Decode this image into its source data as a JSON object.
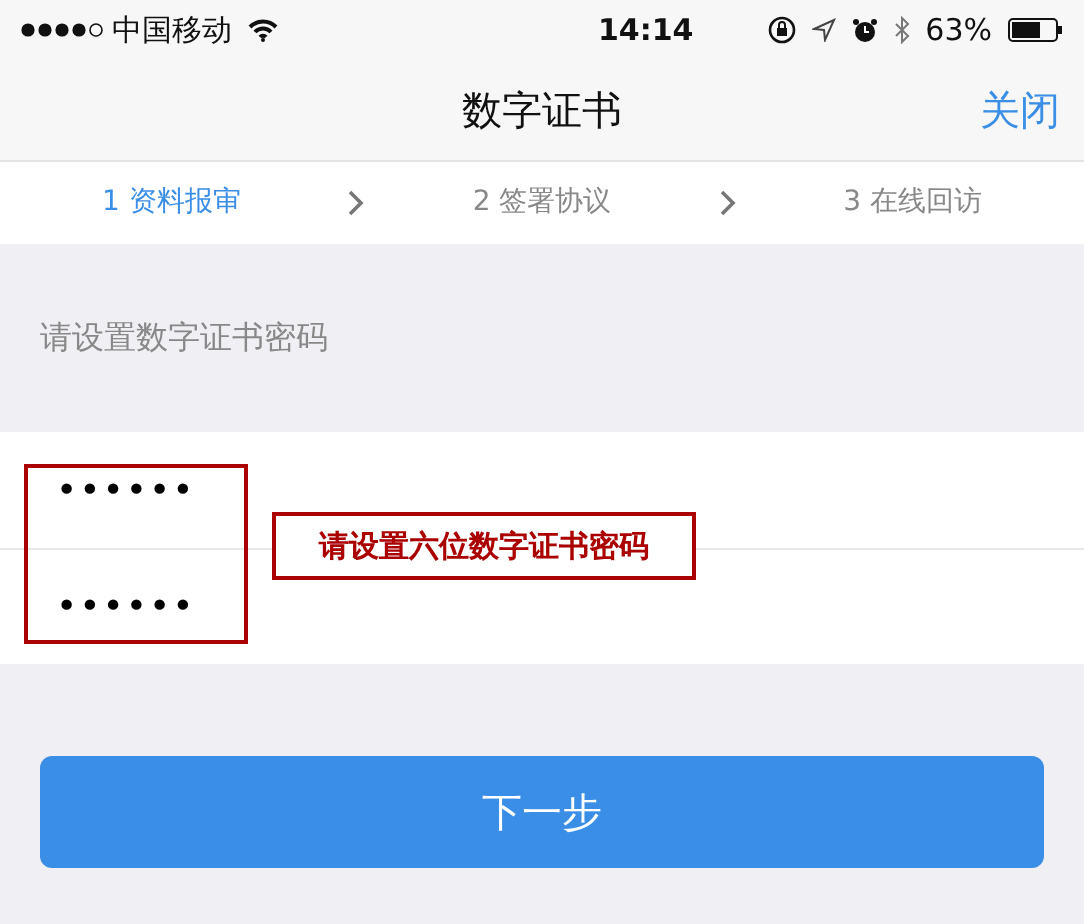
{
  "status_bar": {
    "carrier": "中国移动",
    "time": "14:14",
    "battery": "63%"
  },
  "nav_bar": {
    "title": "数字证书",
    "close": "关闭"
  },
  "steps": [
    {
      "label": "1 资料报审",
      "selected": true
    },
    {
      "label": "2 签署协议",
      "selected": false
    },
    {
      "label": "3 在线回访",
      "selected": false
    }
  ],
  "section_label": "请设置数字证书密码",
  "fields": [
    {
      "value": "••••••"
    },
    {
      "value": "••••••"
    }
  ],
  "annotation": "请设置六位数字证书密码",
  "next_button": "下一步"
}
